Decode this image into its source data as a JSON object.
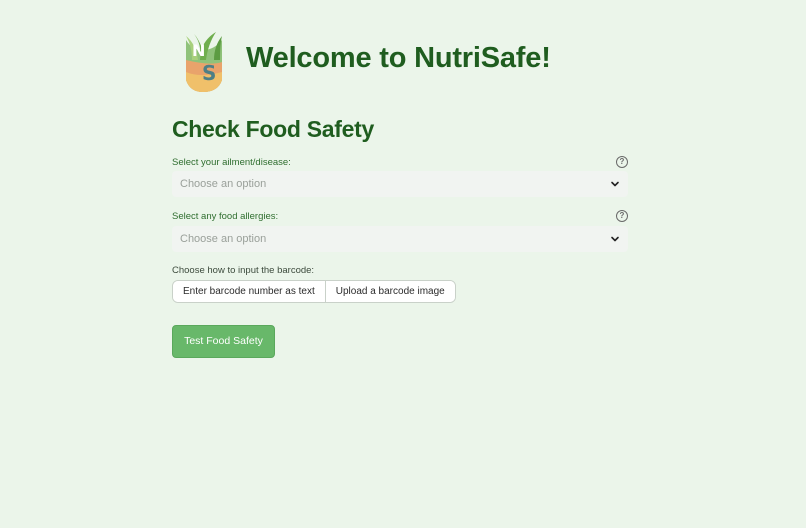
{
  "header": {
    "logo_letters": "NS",
    "title": "Welcome to NutriSafe!"
  },
  "main": {
    "section_title": "Check Food Safety",
    "ailment": {
      "label": "Select your ailment/disease:",
      "placeholder": "Choose an option",
      "help": "?"
    },
    "allergies": {
      "label": "Select any food allergies:",
      "placeholder": "Choose an option",
      "help": "?"
    },
    "barcode": {
      "label": "Choose how to input the barcode:",
      "options": [
        "Enter barcode number as text",
        "Upload a barcode image"
      ]
    },
    "submit_label": "Test Food Safety"
  },
  "colors": {
    "background": "#ebf5ea",
    "heading": "#1f5d1f",
    "button": "#68b86a"
  }
}
